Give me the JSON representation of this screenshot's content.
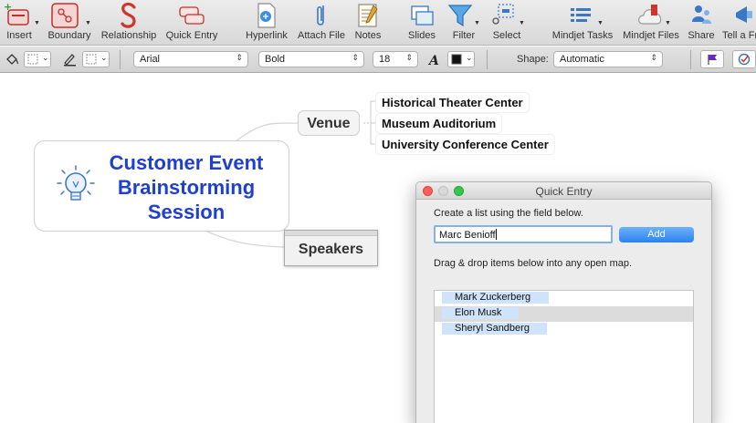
{
  "toolbar": {
    "insert": "Insert",
    "boundary": "Boundary",
    "relationship": "Relationship",
    "quick_entry": "Quick Entry",
    "hyperlink": "Hyperlink",
    "attach_file": "Attach File",
    "notes": "Notes",
    "slides": "Slides",
    "filter": "Filter",
    "select": "Select",
    "mindjet_tasks": "Mindjet Tasks",
    "mindjet_files": "Mindjet Files",
    "share": "Share",
    "tell_a_friend": "Tell a Fr"
  },
  "format_bar": {
    "font": "Arial",
    "weight": "Bold",
    "size": "18",
    "shape_label": "Shape:",
    "shape_value": "Automatic"
  },
  "map": {
    "central_topic": "Customer Event Brainstorming Session",
    "venue": "Venue",
    "speakers": "Speakers",
    "venue_subtopics": [
      "Historical Theater Center",
      "Museum Auditorium",
      "University Conference Center"
    ]
  },
  "quick_entry": {
    "title": "Quick Entry",
    "instruction": "Create a list using the field below.",
    "input_value": "Marc Benioff",
    "add_label": "Add",
    "drag_hint": "Drag & drop items below into any open map.",
    "items": [
      "Mark Zuckerberg",
      "Elon Musk",
      "Sheryl Sandberg"
    ]
  },
  "colors": {
    "central_text": "#1f3fcf",
    "add_button": "#2a82f1",
    "relationship_icon": "#d0342c",
    "list_item_bg": "#cfe3fb"
  }
}
